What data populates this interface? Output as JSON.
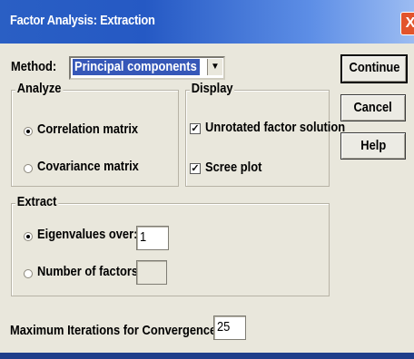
{
  "window": {
    "title": "Factor Analysis: Extraction",
    "close_glyph": "X"
  },
  "method": {
    "label": "Method:",
    "selected": "Principal components"
  },
  "buttons": {
    "continue": "Continue",
    "cancel": "Cancel",
    "help": "Help"
  },
  "analyze": {
    "legend": "Analyze",
    "options": [
      {
        "label": "Correlation matrix",
        "checked": true
      },
      {
        "label": "Covariance matrix",
        "checked": false
      }
    ]
  },
  "display": {
    "legend": "Display",
    "options": [
      {
        "label": "Unrotated factor solution",
        "checked": true
      },
      {
        "label": "Scree plot",
        "checked": true
      }
    ]
  },
  "extract": {
    "legend": "Extract",
    "eigen_label": "Eigenvalues over:",
    "eigen_value": "1",
    "eigen_selected": true,
    "factors_label": "Number of factors:",
    "factors_value": "",
    "factors_selected": false
  },
  "iterations": {
    "label": "Maximum Iterations for Convergence:",
    "value": "25"
  },
  "colors": {
    "title_bar": "#2559c4",
    "dialog_bg": "#e9e7dc",
    "selection": "#3658b8",
    "close_button": "#e2542c"
  }
}
